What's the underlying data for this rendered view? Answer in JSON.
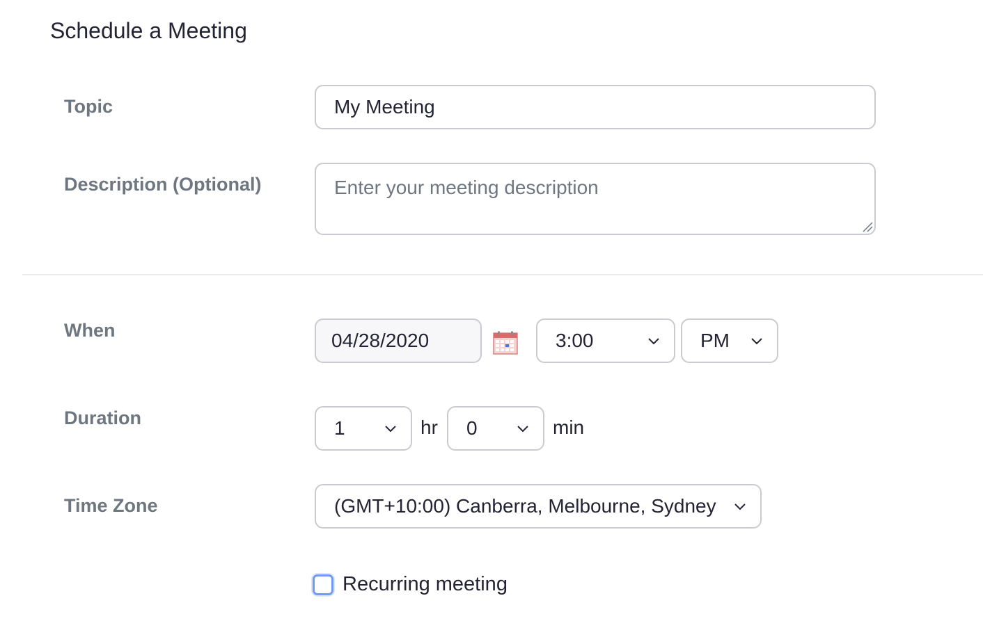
{
  "page": {
    "title": "Schedule a Meeting"
  },
  "topic": {
    "label": "Topic",
    "value": "My Meeting"
  },
  "description": {
    "label": "Description (Optional)",
    "placeholder": "Enter your meeting description"
  },
  "when": {
    "label": "When",
    "date": "04/28/2020",
    "time": "3:00",
    "ampm": "PM",
    "calendar_icon": "calendar-icon"
  },
  "duration": {
    "label": "Duration",
    "hours": "1",
    "hours_unit": "hr",
    "minutes": "0",
    "minutes_unit": "min"
  },
  "timezone": {
    "label": "Time Zone",
    "value": "(GMT+10:00) Canberra, Melbourne, Sydney"
  },
  "recurring": {
    "label": "Recurring meeting",
    "checked": false
  },
  "colors": {
    "label_text": "#6e7680",
    "body_text": "#232333",
    "border": "#c9cbd1",
    "checkbox_focus": "#6f9cf0"
  }
}
